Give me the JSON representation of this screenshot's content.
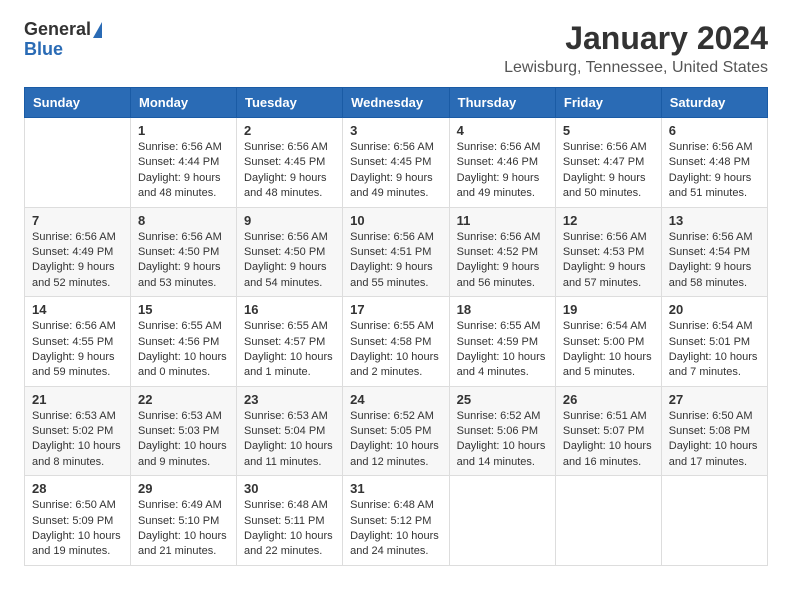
{
  "logo": {
    "general": "General",
    "blue": "Blue"
  },
  "title": "January 2024",
  "subtitle": "Lewisburg, Tennessee, United States",
  "days_header": [
    "Sunday",
    "Monday",
    "Tuesday",
    "Wednesday",
    "Thursday",
    "Friday",
    "Saturday"
  ],
  "weeks": [
    [
      {
        "day": "",
        "sunrise": "",
        "sunset": "",
        "daylight": ""
      },
      {
        "day": "1",
        "sunrise": "Sunrise: 6:56 AM",
        "sunset": "Sunset: 4:44 PM",
        "daylight": "Daylight: 9 hours and 48 minutes."
      },
      {
        "day": "2",
        "sunrise": "Sunrise: 6:56 AM",
        "sunset": "Sunset: 4:45 PM",
        "daylight": "Daylight: 9 hours and 48 minutes."
      },
      {
        "day": "3",
        "sunrise": "Sunrise: 6:56 AM",
        "sunset": "Sunset: 4:45 PM",
        "daylight": "Daylight: 9 hours and 49 minutes."
      },
      {
        "day": "4",
        "sunrise": "Sunrise: 6:56 AM",
        "sunset": "Sunset: 4:46 PM",
        "daylight": "Daylight: 9 hours and 49 minutes."
      },
      {
        "day": "5",
        "sunrise": "Sunrise: 6:56 AM",
        "sunset": "Sunset: 4:47 PM",
        "daylight": "Daylight: 9 hours and 50 minutes."
      },
      {
        "day": "6",
        "sunrise": "Sunrise: 6:56 AM",
        "sunset": "Sunset: 4:48 PM",
        "daylight": "Daylight: 9 hours and 51 minutes."
      }
    ],
    [
      {
        "day": "7",
        "sunrise": "Sunrise: 6:56 AM",
        "sunset": "Sunset: 4:49 PM",
        "daylight": "Daylight: 9 hours and 52 minutes."
      },
      {
        "day": "8",
        "sunrise": "Sunrise: 6:56 AM",
        "sunset": "Sunset: 4:50 PM",
        "daylight": "Daylight: 9 hours and 53 minutes."
      },
      {
        "day": "9",
        "sunrise": "Sunrise: 6:56 AM",
        "sunset": "Sunset: 4:50 PM",
        "daylight": "Daylight: 9 hours and 54 minutes."
      },
      {
        "day": "10",
        "sunrise": "Sunrise: 6:56 AM",
        "sunset": "Sunset: 4:51 PM",
        "daylight": "Daylight: 9 hours and 55 minutes."
      },
      {
        "day": "11",
        "sunrise": "Sunrise: 6:56 AM",
        "sunset": "Sunset: 4:52 PM",
        "daylight": "Daylight: 9 hours and 56 minutes."
      },
      {
        "day": "12",
        "sunrise": "Sunrise: 6:56 AM",
        "sunset": "Sunset: 4:53 PM",
        "daylight": "Daylight: 9 hours and 57 minutes."
      },
      {
        "day": "13",
        "sunrise": "Sunrise: 6:56 AM",
        "sunset": "Sunset: 4:54 PM",
        "daylight": "Daylight: 9 hours and 58 minutes."
      }
    ],
    [
      {
        "day": "14",
        "sunrise": "Sunrise: 6:56 AM",
        "sunset": "Sunset: 4:55 PM",
        "daylight": "Daylight: 9 hours and 59 minutes."
      },
      {
        "day": "15",
        "sunrise": "Sunrise: 6:55 AM",
        "sunset": "Sunset: 4:56 PM",
        "daylight": "Daylight: 10 hours and 0 minutes."
      },
      {
        "day": "16",
        "sunrise": "Sunrise: 6:55 AM",
        "sunset": "Sunset: 4:57 PM",
        "daylight": "Daylight: 10 hours and 1 minute."
      },
      {
        "day": "17",
        "sunrise": "Sunrise: 6:55 AM",
        "sunset": "Sunset: 4:58 PM",
        "daylight": "Daylight: 10 hours and 2 minutes."
      },
      {
        "day": "18",
        "sunrise": "Sunrise: 6:55 AM",
        "sunset": "Sunset: 4:59 PM",
        "daylight": "Daylight: 10 hours and 4 minutes."
      },
      {
        "day": "19",
        "sunrise": "Sunrise: 6:54 AM",
        "sunset": "Sunset: 5:00 PM",
        "daylight": "Daylight: 10 hours and 5 minutes."
      },
      {
        "day": "20",
        "sunrise": "Sunrise: 6:54 AM",
        "sunset": "Sunset: 5:01 PM",
        "daylight": "Daylight: 10 hours and 7 minutes."
      }
    ],
    [
      {
        "day": "21",
        "sunrise": "Sunrise: 6:53 AM",
        "sunset": "Sunset: 5:02 PM",
        "daylight": "Daylight: 10 hours and 8 minutes."
      },
      {
        "day": "22",
        "sunrise": "Sunrise: 6:53 AM",
        "sunset": "Sunset: 5:03 PM",
        "daylight": "Daylight: 10 hours and 9 minutes."
      },
      {
        "day": "23",
        "sunrise": "Sunrise: 6:53 AM",
        "sunset": "Sunset: 5:04 PM",
        "daylight": "Daylight: 10 hours and 11 minutes."
      },
      {
        "day": "24",
        "sunrise": "Sunrise: 6:52 AM",
        "sunset": "Sunset: 5:05 PM",
        "daylight": "Daylight: 10 hours and 12 minutes."
      },
      {
        "day": "25",
        "sunrise": "Sunrise: 6:52 AM",
        "sunset": "Sunset: 5:06 PM",
        "daylight": "Daylight: 10 hours and 14 minutes."
      },
      {
        "day": "26",
        "sunrise": "Sunrise: 6:51 AM",
        "sunset": "Sunset: 5:07 PM",
        "daylight": "Daylight: 10 hours and 16 minutes."
      },
      {
        "day": "27",
        "sunrise": "Sunrise: 6:50 AM",
        "sunset": "Sunset: 5:08 PM",
        "daylight": "Daylight: 10 hours and 17 minutes."
      }
    ],
    [
      {
        "day": "28",
        "sunrise": "Sunrise: 6:50 AM",
        "sunset": "Sunset: 5:09 PM",
        "daylight": "Daylight: 10 hours and 19 minutes."
      },
      {
        "day": "29",
        "sunrise": "Sunrise: 6:49 AM",
        "sunset": "Sunset: 5:10 PM",
        "daylight": "Daylight: 10 hours and 21 minutes."
      },
      {
        "day": "30",
        "sunrise": "Sunrise: 6:48 AM",
        "sunset": "Sunset: 5:11 PM",
        "daylight": "Daylight: 10 hours and 22 minutes."
      },
      {
        "day": "31",
        "sunrise": "Sunrise: 6:48 AM",
        "sunset": "Sunset: 5:12 PM",
        "daylight": "Daylight: 10 hours and 24 minutes."
      },
      {
        "day": "",
        "sunrise": "",
        "sunset": "",
        "daylight": ""
      },
      {
        "day": "",
        "sunrise": "",
        "sunset": "",
        "daylight": ""
      },
      {
        "day": "",
        "sunrise": "",
        "sunset": "",
        "daylight": ""
      }
    ]
  ]
}
